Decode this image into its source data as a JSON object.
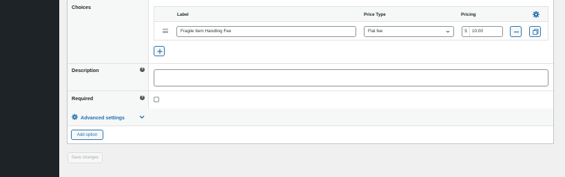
{
  "choices": {
    "label": "Choices",
    "columns": {
      "label": "Label",
      "price_type": "Price Type",
      "pricing": "Pricing"
    },
    "rows": [
      {
        "label": "Fragile Item Handling Fee",
        "price_type": "Flat fee",
        "currency": "$",
        "price": "10.00"
      }
    ],
    "add_icon": "plus-icon",
    "settings_icon": "gear-icon"
  },
  "description": {
    "label": "Description",
    "help_icon": "question-circle-icon",
    "value": ""
  },
  "required": {
    "label": "Required",
    "help_icon": "question-circle-icon",
    "checked": false
  },
  "advanced": {
    "label": "Advanced settings",
    "icon": "gear-icon",
    "expand_icon": "chevron-down-icon"
  },
  "add_option_label": "Add option",
  "save_label": "Save changes",
  "colors": {
    "accent": "#2271b1",
    "sidebar": "#1d2327"
  }
}
